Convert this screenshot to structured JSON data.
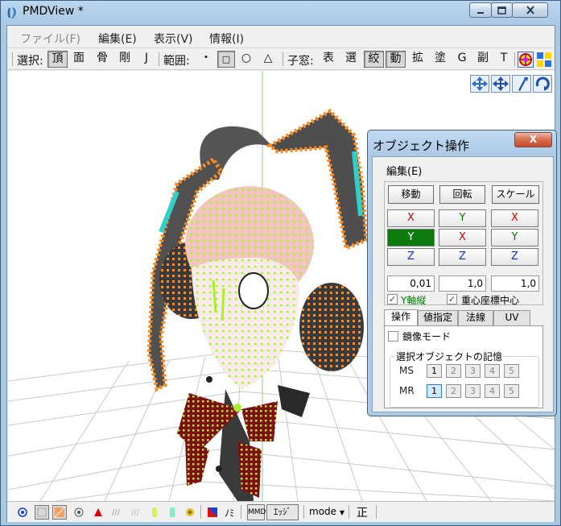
{
  "window": {
    "title": "PMDView *"
  },
  "menu": [
    {
      "label": "ファイル(F)",
      "enabled": false
    },
    {
      "label": "編集(E)",
      "enabled": true
    },
    {
      "label": "表示(V)",
      "enabled": true
    },
    {
      "label": "情報(I)",
      "enabled": true
    }
  ],
  "toolbar": {
    "select_label": "選択:",
    "select_items": [
      "頂",
      "面",
      "骨",
      "剛",
      "J"
    ],
    "range_label": "範囲:",
    "range_items": [
      "・",
      "□",
      "○",
      "△"
    ],
    "child_label": "子窓:",
    "child_items": [
      "表",
      "選",
      "絞",
      "動",
      "拡",
      "塗",
      "G",
      "副",
      "T"
    ]
  },
  "viewport_tools": [
    "move-xy-icon",
    "move-all-icon",
    "pointer-icon",
    "rotate-icon"
  ],
  "statusbar": {
    "mmd_label": "MMD",
    "edge_label": "ｴｯｼﾞ",
    "mode_label": "mode",
    "right_text": "正",
    "mi_label": "ﾉﾐ"
  },
  "dialog": {
    "title": "オブジェクト操作",
    "close_label": "X",
    "menu_label": "編集(E)",
    "ops": [
      "移動",
      "回転",
      "スケール"
    ],
    "axes": [
      [
        "X",
        "Y",
        "Z"
      ],
      [
        "Y",
        "X",
        "Z"
      ],
      [
        "X",
        "Y",
        "Z"
      ]
    ],
    "values": [
      "0,01",
      "1,0",
      "1,0"
    ],
    "checks": [
      {
        "label": "Y軸縦",
        "checked": true
      },
      {
        "label": "重心座標中心",
        "checked": true
      }
    ],
    "tabs": [
      "操作",
      "値指定",
      "法線",
      "UV"
    ],
    "mirror_label": "鏡像モード",
    "memory_group": "選択オブジェクトの記憶",
    "ms_label": "MS",
    "mr_label": "MR",
    "slots": [
      "1",
      "2",
      "3",
      "4",
      "5"
    ]
  },
  "colors": {
    "x_axis": "#d00000",
    "y_axis": "#007a00",
    "z_axis": "#1030c8",
    "selected_axis_bg": "#0d7a0d",
    "vertex_orange": "#ff8a1e",
    "vertex_green": "#a8f02a",
    "skin": "#f4c4c2"
  }
}
